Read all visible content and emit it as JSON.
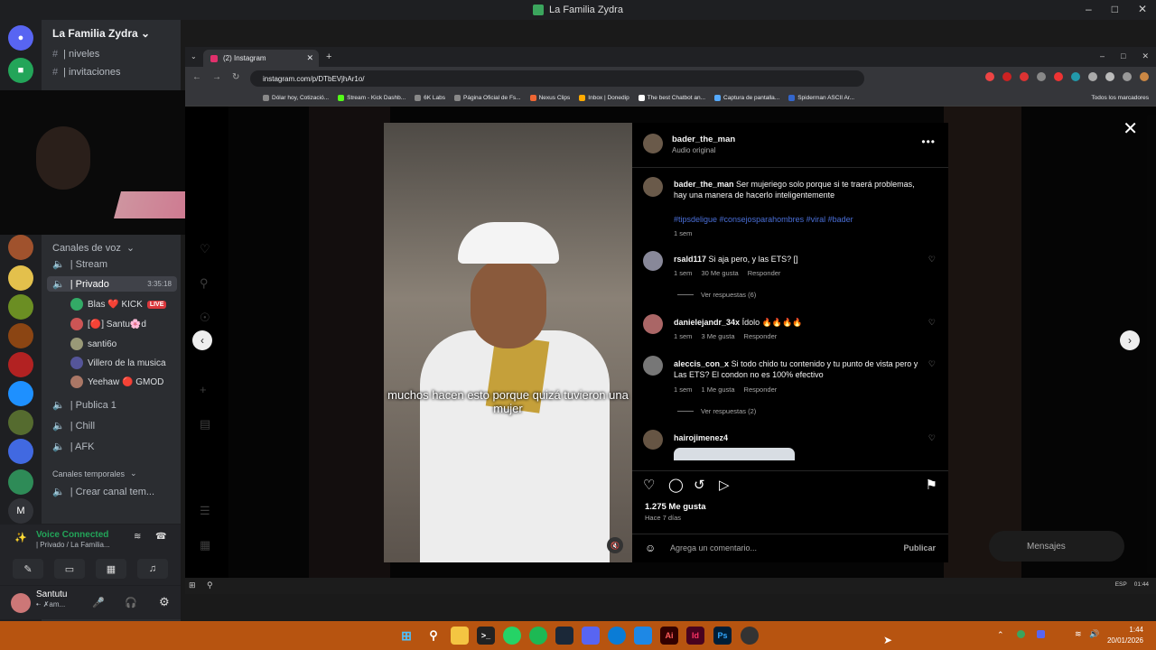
{
  "window": {
    "title": "La Familia Zydra"
  },
  "discord": {
    "server_name": "La Familia Zydra",
    "top_channels": [
      "| niveles",
      "| invitaciones"
    ],
    "voice_category": "Canales de voz",
    "channels": [
      {
        "label": "| Stream"
      },
      {
        "label": "| Privado",
        "time": "3:35:18"
      },
      {
        "label": "| Publica 1"
      },
      {
        "label": "| Chill"
      },
      {
        "label": "| AFK"
      }
    ],
    "users": [
      {
        "name": "Blas ❤️ KICK",
        "badge": "LIVE"
      },
      {
        "name": "[🔴] Santu🌸d"
      },
      {
        "name": "santi6o"
      },
      {
        "name": "Villero de la musica"
      },
      {
        "name": "Yeehaw 🔴 GMOD"
      }
    ],
    "temp_category": "Canales temporales",
    "create_channel": "| Crear canal tem...",
    "voice_connected": "Voice Connected",
    "voice_sub": "| Privado / La Familia...",
    "user_name": "Santutu",
    "user_status": "•· ✗am..."
  },
  "browser": {
    "tab_title": "(2) Instagram",
    "url": "instagram.com/p/DTbEVjhAr1o/",
    "bookmarks": [
      "Dólar hoy, Cotizació...",
      "Stream - Kick Dashb...",
      "6K Labs",
      "Página Oficial de Fs...",
      "Nexus Clips",
      "Inbox | Donedip",
      "The best Chatbot an...",
      "Captura de pantalla...",
      "Spiderman ASCII Ar..."
    ],
    "all_bookmarks": "Todos los marcadores"
  },
  "post": {
    "author": "bader_the_man",
    "audio": "Audio original",
    "caption_user": "bader_the_man",
    "caption": "Ser mujeriego solo porque si te traerá problemas, hay una manera de hacerlo inteligentemente",
    "tags": "#tipsdeligue #consejosparahombres #viral #bader",
    "caption_time": "1 sem",
    "subtitle": "muchos hacen esto porque quizá tuvieron una mujer",
    "comments": [
      {
        "user": "rsald117",
        "text": "Si aja pero, y las ETS? []",
        "time": "1 sem",
        "likes": "30 Me gusta",
        "reply": "Responder",
        "view_replies": "Ver respuestas (6)"
      },
      {
        "user": "danielejandr_34x",
        "text": "Ídolo 🔥🔥🔥🔥",
        "time": "1 sem",
        "likes": "3 Me gusta",
        "reply": "Responder"
      },
      {
        "user": "aleccis_con_x",
        "text": "Si todo chido tu contenido y tu punto de vista pero y Las ETS? El condon no es 100% efectivo",
        "time": "1 sem",
        "likes": "1 Me gusta",
        "reply": "Responder",
        "view_replies": "Ver respuestas (2)"
      },
      {
        "user": "hairojimenez4",
        "text": ""
      }
    ],
    "like_count": "1.275 Me gusta",
    "posted": "Hace 7 días",
    "comment_placeholder": "Agrega un comentario...",
    "publish": "Publicar",
    "messages": "Mensajes"
  },
  "inner_tray": {
    "lang": "ESP",
    "time": "01:44"
  },
  "tray": {
    "time": "1:44",
    "date": "20/01/2026"
  }
}
